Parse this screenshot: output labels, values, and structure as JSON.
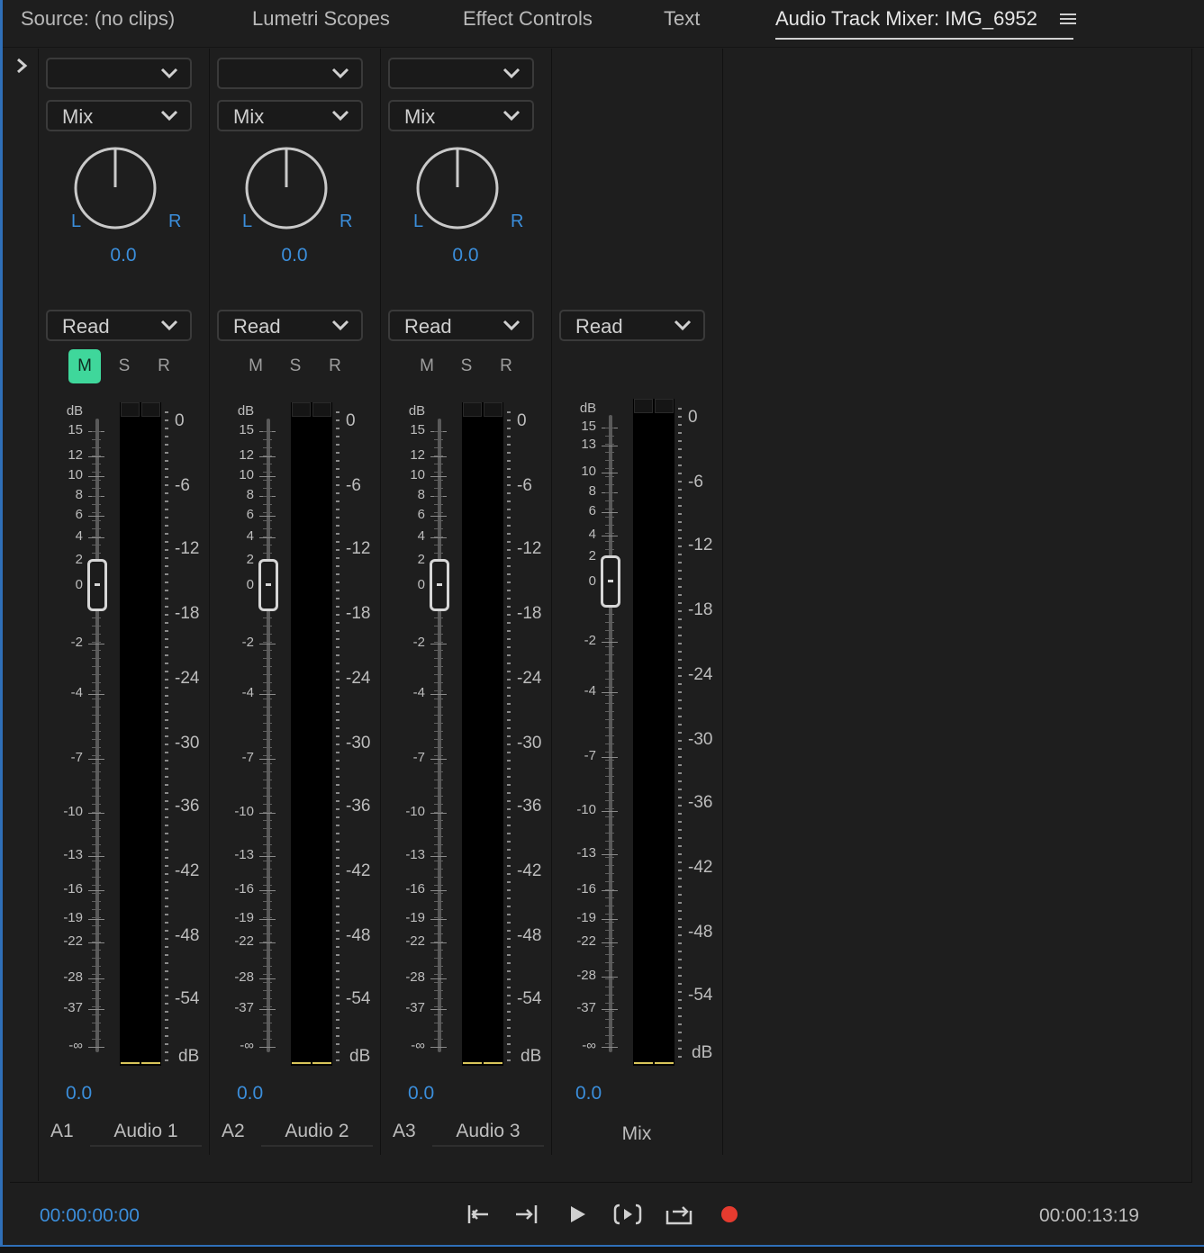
{
  "tabs": [
    {
      "label": "Source: (no clips)"
    },
    {
      "label": "Lumetri Scopes"
    },
    {
      "label": "Effect Controls"
    },
    {
      "label": "Text"
    },
    {
      "label": "Audio Track Mixer: IMG_6952"
    }
  ],
  "tracks": [
    {
      "id": "A1",
      "name": "Audio 1",
      "effect": "",
      "send": "Mix",
      "pan": "0.0",
      "pan_left": "L",
      "pan_right": "R",
      "automation": "Read",
      "mute": "M",
      "solo": "S",
      "record": "R",
      "mute_on": true,
      "volume": "0.0",
      "db_unit": "dB"
    },
    {
      "id": "A2",
      "name": "Audio 2",
      "effect": "",
      "send": "Mix",
      "pan": "0.0",
      "pan_left": "L",
      "pan_right": "R",
      "automation": "Read",
      "mute": "M",
      "solo": "S",
      "record": "R",
      "mute_on": false,
      "volume": "0.0",
      "db_unit": "dB"
    },
    {
      "id": "A3",
      "name": "Audio 3",
      "effect": "",
      "send": "Mix",
      "pan": "0.0",
      "pan_left": "L",
      "pan_right": "R",
      "automation": "Read",
      "mute": "M",
      "solo": "S",
      "record": "R",
      "mute_on": false,
      "volume": "0.0",
      "db_unit": "dB"
    }
  ],
  "master": {
    "name": "Mix",
    "automation": "Read",
    "volume": "0.0",
    "db_unit": "dB"
  },
  "fader_scale": [
    "15",
    "12",
    "10",
    "8",
    "6",
    "4",
    "2",
    "0",
    "-2",
    "-4",
    "-7",
    "-10",
    "-13",
    "-16",
    "-19",
    "-22",
    "-28",
    "-37",
    "-∞"
  ],
  "master_fader_scale": [
    "15",
    "13",
    "10",
    "8",
    "6",
    "4",
    "2",
    "0",
    "-2",
    "-4",
    "-7",
    "-10",
    "-13",
    "-16",
    "-19",
    "-22",
    "-28",
    "-37",
    "-∞"
  ],
  "meter_scale": [
    "0",
    "-6",
    "-12",
    "-18",
    "-24",
    "-30",
    "-36",
    "-42",
    "-48",
    "-54",
    "dB"
  ],
  "footer": {
    "current_time": "00:00:00:00",
    "duration": "00:00:13:19"
  },
  "icons": [
    "hamburger-menu-icon",
    "chevron-right-icon",
    "chevron-down-icon",
    "go-to-in-icon",
    "go-to-out-icon",
    "play-icon",
    "play-in-to-out-icon",
    "loop-icon",
    "record-icon"
  ],
  "colors": {
    "accent": "#3b8edb",
    "mute_on": "#3fd79b",
    "record": "#e53b2f",
    "meter_floor": "#d9c55a"
  }
}
